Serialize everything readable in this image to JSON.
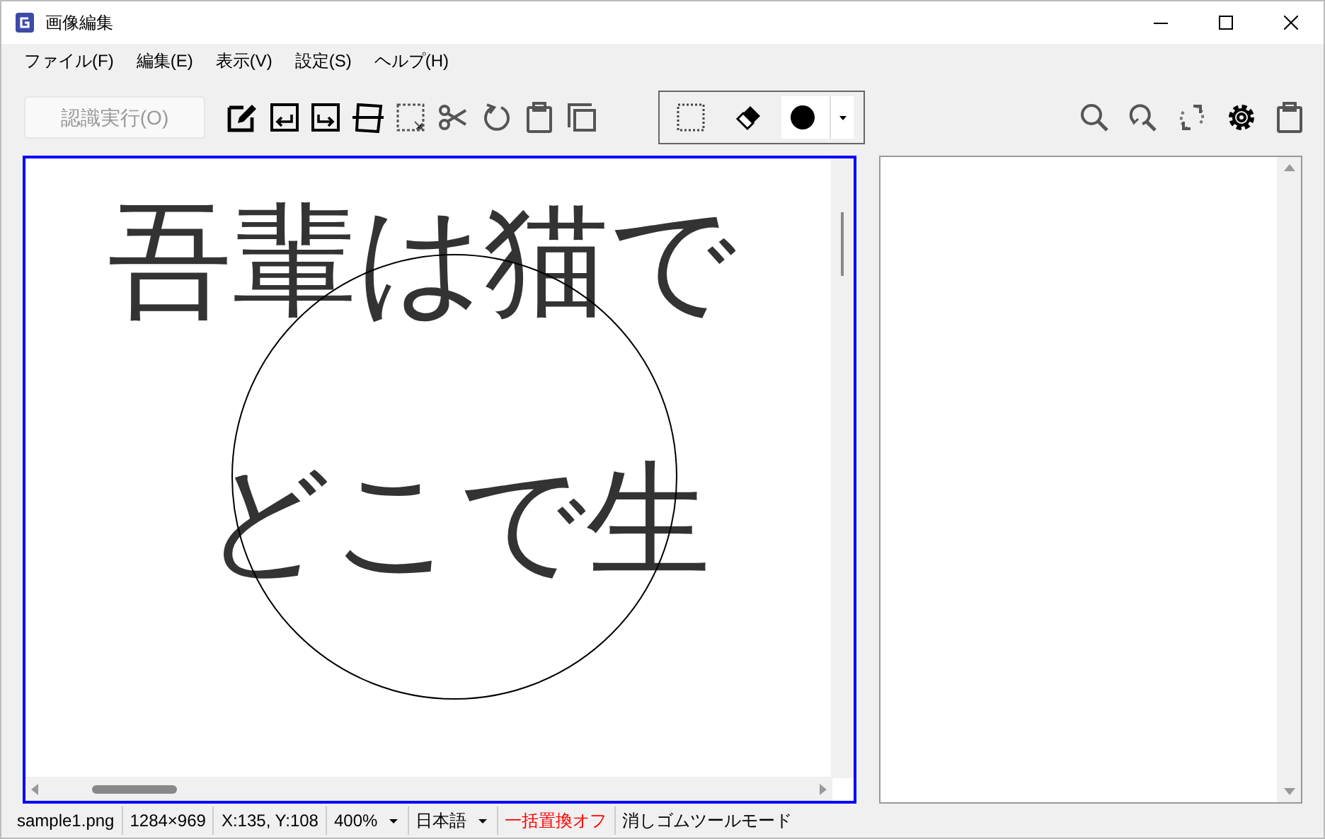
{
  "window": {
    "title": "画像編集"
  },
  "menu": [
    "ファイル(F)",
    "編集(E)",
    "表示(V)",
    "設定(S)",
    "ヘルプ(H)"
  ],
  "toolbar": {
    "run_button": {
      "label": "認識実行(O)",
      "disabled": true
    }
  },
  "canvas": {
    "lines": [
      "吾輩は猫で",
      "どこで生"
    ]
  },
  "status_bar": [
    {
      "text": "sample1.png",
      "kind": "text",
      "color": "#000000"
    },
    {
      "text": "1284×969",
      "kind": "text",
      "color": "#000000"
    },
    {
      "text": "X:135, Y:108",
      "kind": "text",
      "color": "#000000"
    },
    {
      "text": "400%",
      "kind": "dropdown",
      "color": "#000000"
    },
    {
      "text": "日本語",
      "kind": "dropdown",
      "color": "#000000"
    },
    {
      "text": "一括置換オフ",
      "kind": "text",
      "color": "#ff0000"
    },
    {
      "text": "消しゴムツールモード",
      "kind": "text",
      "color": "#000000"
    }
  ]
}
